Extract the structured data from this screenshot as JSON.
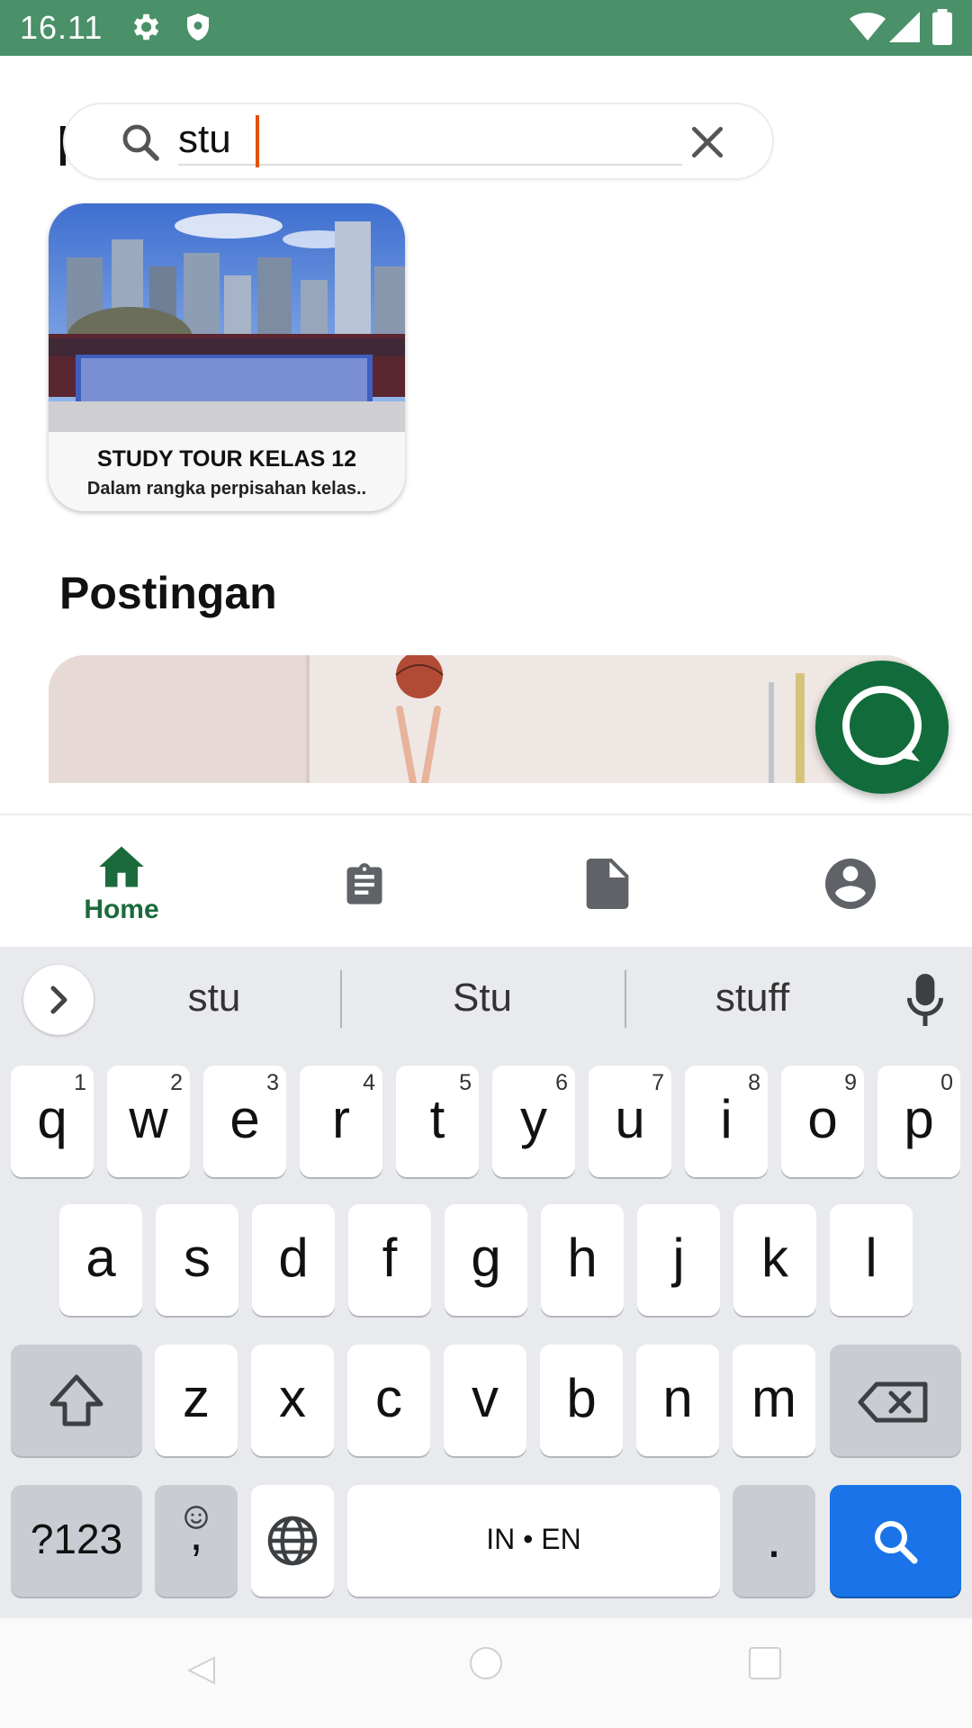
{
  "status_bar": {
    "time": "16.11",
    "icons": [
      "settings-icon",
      "shield-icon",
      "wifi-icon",
      "signal-icon",
      "battery-icon"
    ],
    "background": "#4a9068"
  },
  "search": {
    "value": "stu",
    "placeholder": ""
  },
  "results": [
    {
      "title": "STUDY TOUR KELAS 12",
      "subtitle": "Dalam rangka perpisahan kelas.."
    }
  ],
  "sections": {
    "posts_title": "Postingan"
  },
  "bottom_nav": {
    "items": [
      {
        "label": "Home",
        "icon": "home-icon",
        "active": true
      },
      {
        "label": "",
        "icon": "clipboard-icon",
        "active": false
      },
      {
        "label": "",
        "icon": "document-icon",
        "active": false
      },
      {
        "label": "",
        "icon": "account-icon",
        "active": false
      }
    ],
    "active_color": "#1b6a3c"
  },
  "keyboard": {
    "suggestions": [
      "stu",
      "Stu",
      "stuff"
    ],
    "row1": [
      {
        "k": "q",
        "h": "1"
      },
      {
        "k": "w",
        "h": "2"
      },
      {
        "k": "e",
        "h": "3"
      },
      {
        "k": "r",
        "h": "4"
      },
      {
        "k": "t",
        "h": "5"
      },
      {
        "k": "y",
        "h": "6"
      },
      {
        "k": "u",
        "h": "7"
      },
      {
        "k": "i",
        "h": "8"
      },
      {
        "k": "o",
        "h": "9"
      },
      {
        "k": "p",
        "h": "0"
      }
    ],
    "row2": [
      "a",
      "s",
      "d",
      "f",
      "g",
      "h",
      "j",
      "k",
      "l"
    ],
    "row3": [
      "z",
      "x",
      "c",
      "v",
      "b",
      "n",
      "m"
    ],
    "symbols_label": "?123",
    "emoji_label": ",",
    "space_label": "IN • EN",
    "period_label": ".",
    "action_color": "#1a73e8"
  }
}
